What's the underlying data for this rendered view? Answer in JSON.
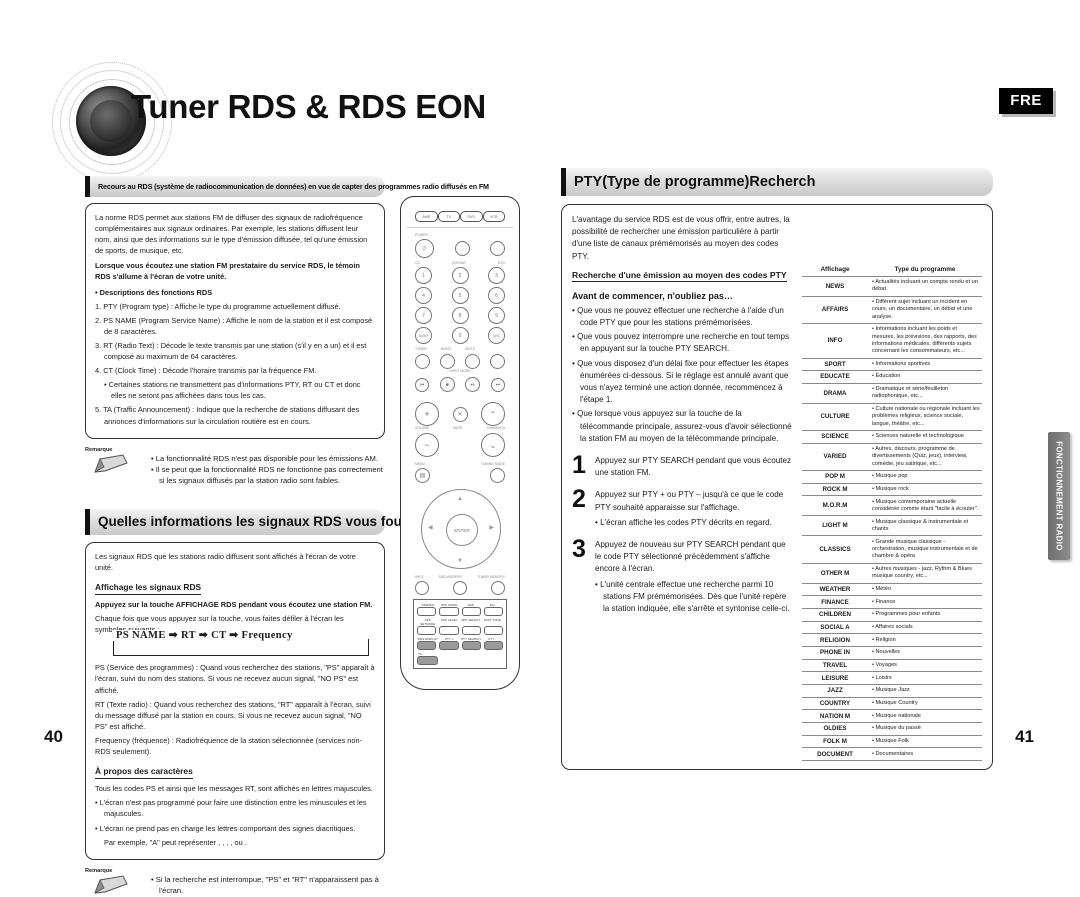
{
  "document": {
    "title": "Tuner RDS & RDS EON",
    "language_badge": "FRE",
    "side_tab": "FONCTIONNEMENT RADIO",
    "page_left": "40",
    "page_right": "41"
  },
  "left_page": {
    "banner1": "Recours au RDS (système de radiocommunication de données) en vue de capter des programmes radio diffusés en FM",
    "intro": "La norme RDS permet aux stations FM de diffuser des signaux de radiofréquence complémentaires aux signaux ordinaires. Par exemple, les stations diffusent leur nom, ainsi que des informations sur le type d'émission diffusée, tel qu'une émission de sports, de musique, etc.",
    "bold_note": "Lorsque vous écoutez une station FM prestataire du service RDS, le témoin RDS s'allume à l'écran de votre unité.",
    "functions_head": "• Descriptions des fonctions RDS",
    "functions": [
      "1. PTY (Program type) : Affiche le type du programme actuellement diffusé.",
      "2. PS NAME (Program Service Name) : Affiche le nom de la station et il est composé de 8 caractères.",
      "3. RT (Radio Text) : Décode le texte transmis par une station (s'il y en a un) et il est composé au maximum de 64 caractères.",
      "4. CT (Clock Time) : Décode l'horaire transmis par la fréquence FM.",
      "• Certaines stations ne transmettent pas d'informations PTY, RT ou CT et donc elles ne seront pas affichées dans tous les cas.",
      "5. TA (Traffic Announcement) : Indique que la recherche de stations diffusant des annonces d'informations sur la circulation routière est en cours."
    ],
    "note1_label": "Remarque",
    "note1_items": [
      "• La fonctionnalité RDS n'est pas disponible pour les émissions AM.",
      "• Il se peut que la fonctionnalité RDS ne fonctionne pas correctement si les signaux diffusés par la station radio sont faibles."
    ],
    "banner2": "Quelles informations les signaux RDS vous fournissent-ils?",
    "signals_intro": "Les signaux RDS que les stations radio diffusent sont affichés à l'écran de votre unité.",
    "display_head": "Affichage les signaux RDS",
    "display_bold": "Appuyez sur la touche AFFICHAGE RDS pendant vous écoutez une station FM.",
    "display_text": "Chaque fois que vous appuyez sur la touche, vous faites défiler à l'écran les symboles suivants :",
    "flow": "PS NAME ➡ RT ➡ CT ➡ Frequency",
    "defs": [
      "PS (Service des programmes) : Quand vous recherchez des stations, \"PS\" apparaît à l'écran, suivi du nom des stations. Si vous ne recevez aucun signal, \"NO PS\" est affiché.",
      "RT (Texte radio) : Quand vous recherchez des stations, \"RT\" apparaît à l'écran, suivi du message diffusé par la station en cours. Si vous ne recevez aucun signal, \"NO PS\" est affiché.",
      "Frequency (fréquence) : Radiofréquence de la station sélectionnée (services non-RDS seulement)."
    ],
    "chars_head": "À propos des caractères",
    "chars_intro": "Tous les codes PS et ainsi que les messages RT, sont affichés en lettres majuscules.",
    "chars_items": [
      "• L'écran n'est pas programmé pour faire une distinction entre les minuscules et les majuscules.",
      "• L'écran ne prend pas en charge les lettres comportant des signes diacritiques.",
      "Par exemple, \"A\" peut représenter , , , ,    ou ."
    ],
    "note2_label": "Remarque",
    "note2_items": [
      "• Si la recherche est interrompue, \"PS\" et \"RT\" n'apparaissent pas à l'écran."
    ]
  },
  "remote": {
    "source_buttons": [
      "AMP",
      "TV",
      "DVD",
      "VCR"
    ],
    "labels_top": [
      "POWER",
      "TUNER",
      "TV/VIDEO"
    ],
    "labels_num": [
      "CD",
      "VCR/SAT",
      "DVD"
    ],
    "keys": [
      "1",
      "2",
      "3",
      "4",
      "5",
      "6",
      "7",
      "8",
      "9",
      "SLEEP",
      "0",
      "CRC"
    ],
    "labels_mode": [
      "TUNER",
      "MO/ST",
      "MUTE",
      "INPUT MODE"
    ],
    "labels_mid": [
      "MENU",
      "TUNING MODE",
      "ENTER"
    ],
    "labels_low": [
      "INFO",
      "SUB WOOFER",
      "TUNER MEMORY"
    ],
    "labels_keyblock": [
      "STEREO",
      "SPK MODE",
      "DSP",
      "EQ",
      "SPK SETMODE",
      "SPK LEVEL",
      "SPK SELECT",
      "TEST TONE"
    ],
    "rds_buttons": [
      "RDS DISPLAY",
      "PTY +",
      "PTY SEARCH",
      "PTY -",
      "TA"
    ],
    "volume_label": "VOLUME",
    "tuning_label": "TUNING/CH",
    "mute_label": "MUTE"
  },
  "right_page": {
    "banner": "PTY(Type de programme)Recherch",
    "intro": "L'avantage du service RDS est de vous offrir, entre autres, la possibilité de rechercher une émission particulière à partir d'une liste de canaux prémémorisés au moyen des codes PTY.",
    "search_head": "Recherche d'une émission au moyen des codes PTY",
    "before_head": "Avant de commencer, n'oubliez pas…",
    "before_items": [
      "• Que vous ne pouvez effectuer une recherche à l'aide d'un code PTY que pour les stations prémémorisées.",
      "• Que vous pouvez interrompre une recherche en tout temps en appuyant sur la touche PTY SEARCH.",
      "• Que vous disposez d'un délai fixe pour effectuer les étapes énumérées ci-dessous. Si le réglage est annulé avant que vous n'ayez terminé une action donnée, recommencez à l'étape 1.",
      "• Que lorsque vous appuyez sur la touche de la télécommande principale, assurez-vous d'avoir sélectionné la station FM au moyen de la télécommande principale."
    ],
    "steps": [
      {
        "n": "1",
        "text": "Appuyez sur PTY SEARCH pendant que vous écoutez une station FM.",
        "sub": []
      },
      {
        "n": "2",
        "text": "Appuyez sur PTY + ou PTY – jusqu'à ce que le code PTY souhaité apparaisse sur l'affichage.",
        "sub": [
          "• L'écran affiche les codes PTY décrits en regard."
        ]
      },
      {
        "n": "3",
        "text": "Appuyez de nouveau sur PTY SEARCH pendant que le code PTY sélectionné précédemment s'affiche encore à l'écran.",
        "sub": [
          "• L'unité centrale effectue une recherche parmi 10 stations FM prémémorisées. Dès que l'unité repère la station indiquée, elle s'arrête et syntonise celle-ci."
        ]
      }
    ],
    "table": {
      "headers": [
        "Affichage",
        "Type du programme"
      ],
      "rows": [
        {
          "code": "NEWS",
          "desc": "• Actualités incluant un compte rendu et un débat"
        },
        {
          "code": "AFFAIRS",
          "desc": "• Différent sujet incluant un incident en cours, un documentaire, un débat et une analyse."
        },
        {
          "code": "INFO",
          "desc": "• Informations incluant les poids et mesures, les prévisions, des rapports, des informations médicales, différents sujets concernant les consommateurs, etc..."
        },
        {
          "code": "SPORT",
          "desc": "• Informations sportives"
        },
        {
          "code": "EDUCATE",
          "desc": "• Éducation"
        },
        {
          "code": "DRAMA",
          "desc": "• Dramatique et série/feuilleton radiophonique, etc..."
        },
        {
          "code": "CULTURE",
          "desc": "• Culture nationale ou régionale incluant les problèmes religieux, science sociale, langue, théâtre, etc..."
        },
        {
          "code": "SCIENCE",
          "desc": "• Sciences naturelle et technologique"
        },
        {
          "code": "VARIED",
          "desc": "• Autres, discours, programme de divertissements (Quiz, jeux), interview, comédie, jeu satirique, etc..."
        },
        {
          "code": "POP M",
          "desc": "• Musique pop"
        },
        {
          "code": "ROCK M",
          "desc": "• Musique rock"
        },
        {
          "code": "M.O.R.M",
          "desc": "• Musique contemporaine actuelle considérée comme étant \"facile à écouter\"."
        },
        {
          "code": "LIGHT M",
          "desc": "• Musique classique & instrumentale et chants"
        },
        {
          "code": "CLASSICS",
          "desc": "• Grande musique classique - orchestration, musique instrumentale et de chambre & opéra"
        },
        {
          "code": "OTHER M",
          "desc": "• Autres musiques - jazz, Rythm & Blues musique country, etc..."
        },
        {
          "code": "WEATHER",
          "desc": "• Météo"
        },
        {
          "code": "FINANCE",
          "desc": "• Finance"
        },
        {
          "code": "CHILDREN",
          "desc": "• Programmes pour enfants"
        },
        {
          "code": "SOCIAL A",
          "desc": "• Affaires socials"
        },
        {
          "code": "RELIGION",
          "desc": "• Religion"
        },
        {
          "code": "PHONE IN",
          "desc": "• Nouvelles"
        },
        {
          "code": "TRAVEL",
          "desc": "• Voyages"
        },
        {
          "code": "LEISURE",
          "desc": "• Loisirs"
        },
        {
          "code": "JAZZ",
          "desc": "• Musique Jazz"
        },
        {
          "code": "COUNTRY",
          "desc": "• Musique Country"
        },
        {
          "code": "NATION M",
          "desc": "• Musique nationale"
        },
        {
          "code": "OLDIES",
          "desc": "• Musique du passé"
        },
        {
          "code": "FOLK M",
          "desc": "• Musique Folk"
        },
        {
          "code": "DOCUMENT",
          "desc": "• Documentaires"
        }
      ]
    }
  }
}
